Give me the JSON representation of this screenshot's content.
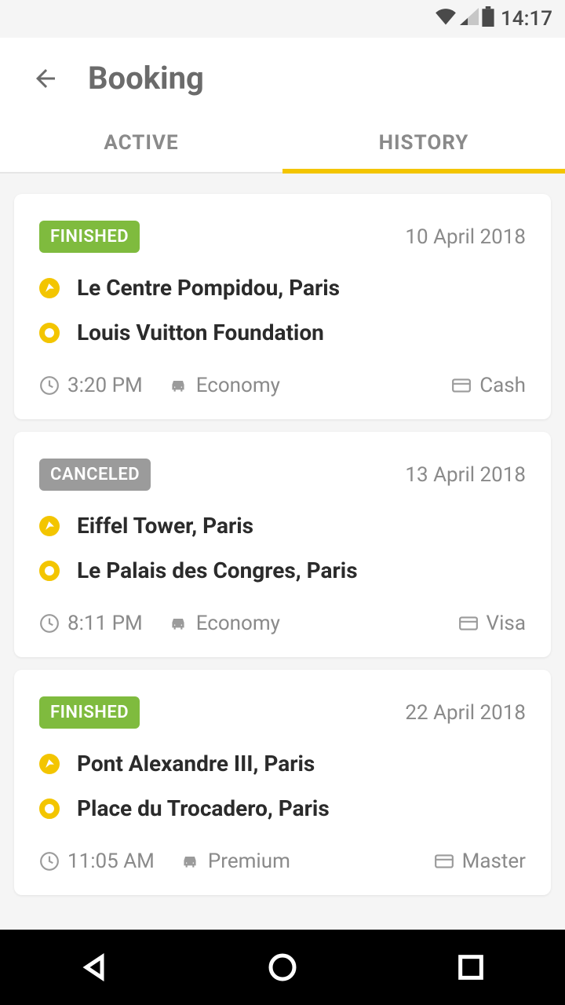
{
  "status_bar": {
    "time": "14:17"
  },
  "header": {
    "title": "Booking"
  },
  "tabs": {
    "active_label": "ACTIVE",
    "history_label": "HISTORY",
    "selected": "history"
  },
  "status_labels": {
    "finished": "FINISHED",
    "canceled": "CANCELED"
  },
  "bookings": [
    {
      "status": "finished",
      "date": "10 April 2018",
      "pickup": "Le Centre Pompidou, Paris",
      "dropoff": "Louis Vuitton Foundation",
      "time": "3:20 PM",
      "car_class": "Economy",
      "payment": "Cash"
    },
    {
      "status": "canceled",
      "date": "13 April 2018",
      "pickup": "Eiffel Tower, Paris",
      "dropoff": "Le Palais des Congres, Paris",
      "time": "8:11 PM",
      "car_class": "Economy",
      "payment": "Visa"
    },
    {
      "status": "finished",
      "date": "22 April 2018",
      "pickup": "Pont Alexandre III, Paris",
      "dropoff": "Place du Trocadero, Paris",
      "time": "11:05 AM",
      "car_class": "Premium",
      "payment": "Master"
    }
  ]
}
